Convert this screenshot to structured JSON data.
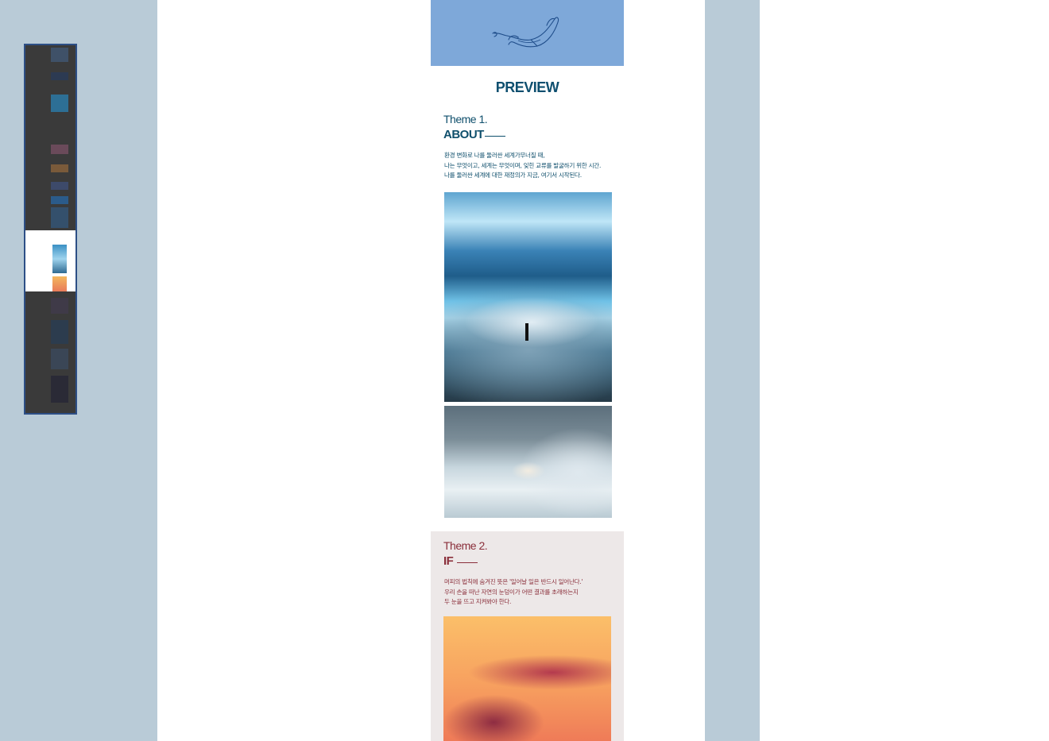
{
  "layout_colors": {
    "side_panel": "#b9cbd7",
    "hero": "#7ea8d9",
    "theme1_text": "#0f4f6c",
    "theme2_text": "#8a2e3a",
    "theme2_bg": "#ede8e8"
  },
  "minimap": {
    "label": "page-minimap"
  },
  "hero": {
    "icon": "whale-icon"
  },
  "preview": {
    "title": "PREVIEW"
  },
  "theme1": {
    "label": "Theme 1.",
    "title": "ABOUT",
    "lines": [
      "환경 변화로 나를 둘러싼 세계가무너질 때,",
      "나는 무엇이고, 세계는 무엇이며, 잊힌 교류를 발굴하기 위한 시간.",
      "나를 둘러싼 세계에 대한 재정의가 지금, 여기서 시작된다."
    ]
  },
  "theme2": {
    "label": "Theme 2.",
    "title": "IF",
    "lines": [
      "머피의 법칙에 숨겨진 뜻은 '일어날 일은 반드시 일어난다.'",
      "우리 손을 떠난 자연의 눈덩이가 어떤 결과를 초래하는지",
      "두 눈을 뜨고 지켜봐야 한다."
    ]
  }
}
